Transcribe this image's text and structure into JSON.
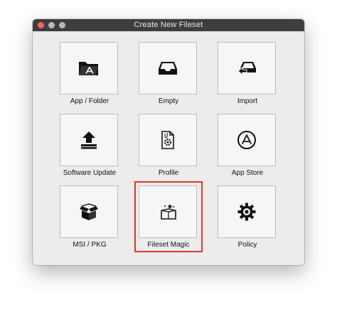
{
  "window": {
    "title": "Create New Fileset"
  },
  "tiles": [
    {
      "label": "App / Folder",
      "icon": "app-folder-icon"
    },
    {
      "label": "Empty",
      "icon": "empty-tray-icon"
    },
    {
      "label": "Import",
      "icon": "import-icon"
    },
    {
      "label": "Software Update",
      "icon": "software-update-icon"
    },
    {
      "label": "Profile",
      "icon": "profile-icon"
    },
    {
      "label": "App Store",
      "icon": "app-store-icon"
    },
    {
      "label": "MSI / PKG",
      "icon": "msi-pkg-icon"
    },
    {
      "label": "Fileset Magic",
      "icon": "fileset-magic-icon"
    },
    {
      "label": "Policy",
      "icon": "policy-gear-icon"
    }
  ],
  "selected_tile": "Fileset Magic",
  "colors": {
    "titlebar": "#3e3e40",
    "window_bg": "#ececec",
    "selection_border": "#e2392a",
    "close_button": "#fe5f57"
  }
}
